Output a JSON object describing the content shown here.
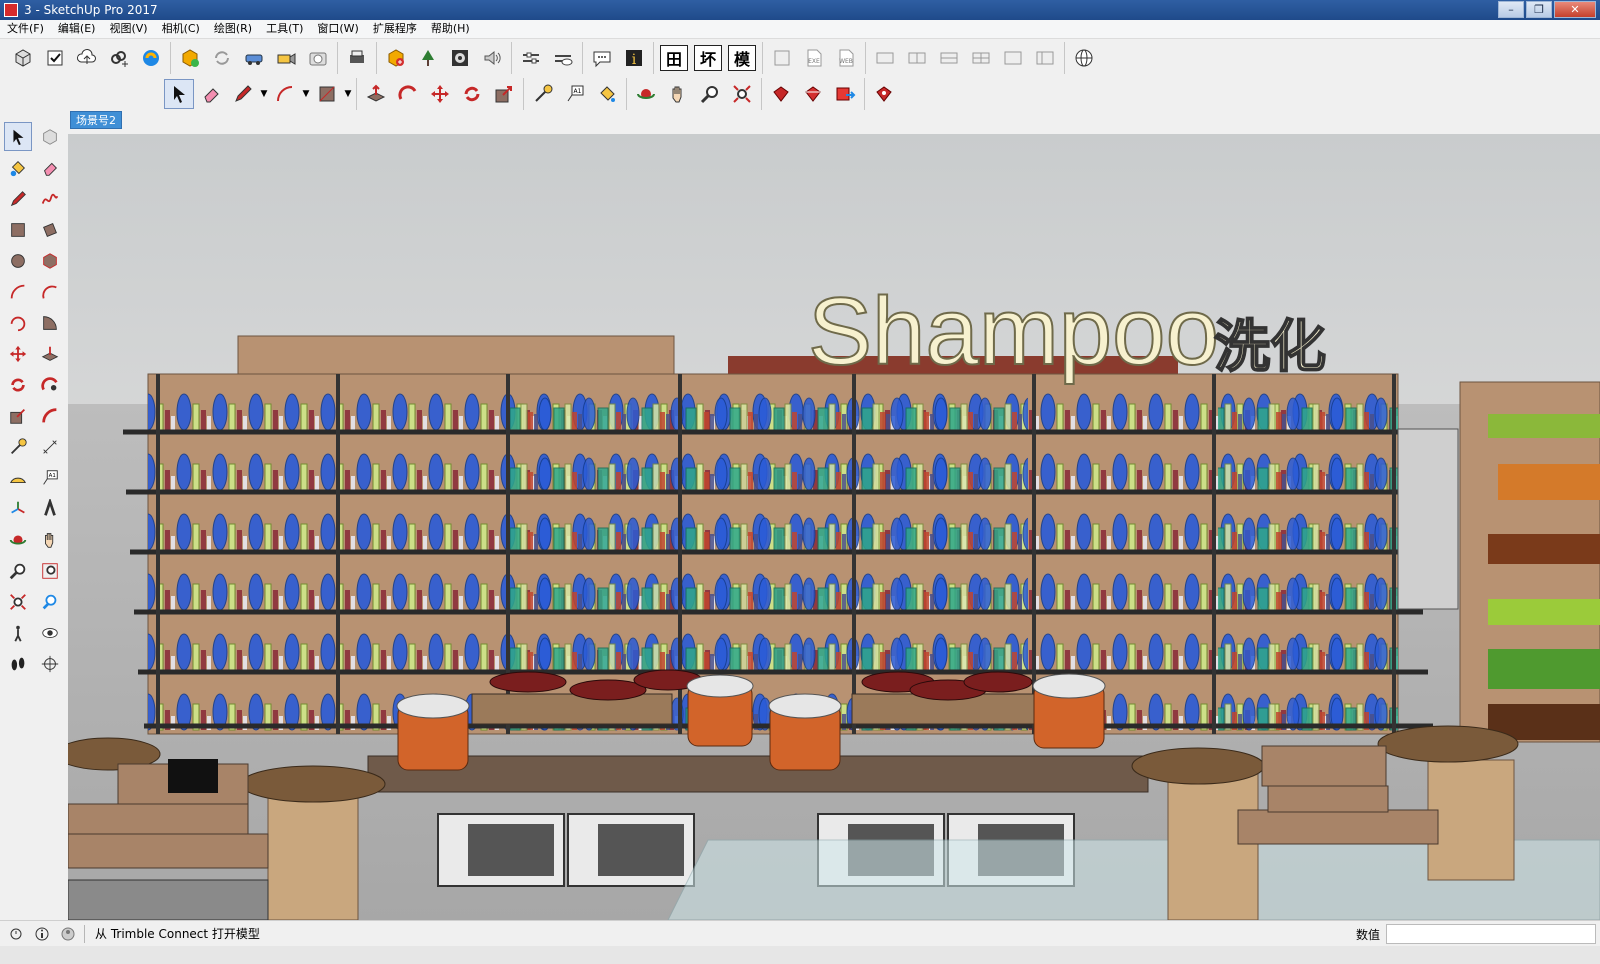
{
  "window": {
    "title": "3 - SketchUp Pro 2017"
  },
  "menu": [
    "文件(F)",
    "编辑(E)",
    "视图(V)",
    "相机(C)",
    "绘图(R)",
    "工具(T)",
    "窗口(W)",
    "扩展程序",
    "帮助(H)"
  ],
  "toolbar_text_tools": [
    "田",
    "坏",
    "模"
  ],
  "scene_tab": "场景号2",
  "viewport": {
    "sign_text": "Shampoo",
    "sign_cn": "洗化"
  },
  "status": {
    "message": "从 Trimble Connect 打开模型",
    "measure_label": "数值",
    "measure_value": ""
  },
  "colors": {
    "accent": "#3f8fd6",
    "title_bar": "#1f4a8a",
    "sign": "#f7f1cf",
    "wood": "#b89272",
    "shelf": "#2a2a2a"
  }
}
